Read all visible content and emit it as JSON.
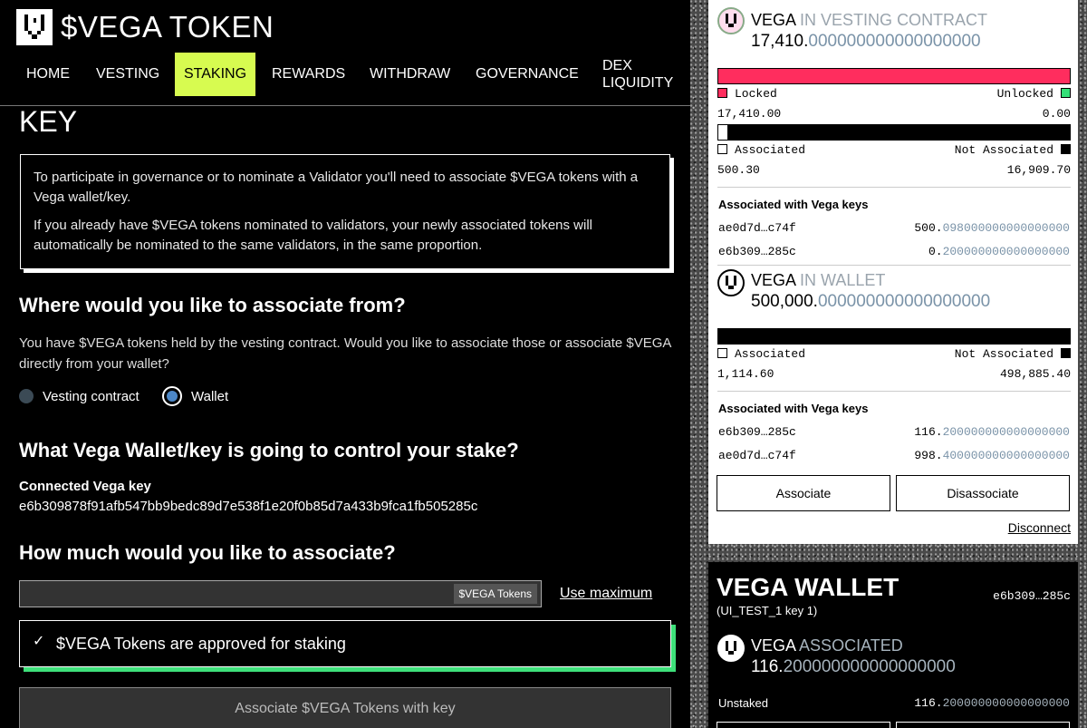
{
  "header": {
    "brand": "$VEGA TOKEN",
    "nav": [
      {
        "label": "HOME"
      },
      {
        "label": "VESTING"
      },
      {
        "label": "STAKING",
        "active": true
      },
      {
        "label": "REWARDS"
      },
      {
        "label": "WITHDRAW"
      },
      {
        "label": "GOVERNANCE"
      },
      {
        "label": "DEX LIQUIDITY"
      }
    ]
  },
  "main": {
    "heading": "KEY",
    "info": {
      "p1": "To participate in governance or to nominate a Validator you'll need to associate $VEGA tokens with a Vega wallet/key.",
      "p2": "If you already have $VEGA tokens nominated to validators, your newly associated tokens will automatically be nominated to the same validators, in the same proportion."
    },
    "from_heading": "Where would you like to associate from?",
    "from_text": "You have $VEGA tokens held by the vesting contract. Would you like to associate those or associate $VEGA directly from your wallet?",
    "radio_options": [
      {
        "label": "Vesting contract",
        "selected": false
      },
      {
        "label": "Wallet",
        "selected": true
      }
    ],
    "control_heading": "What Vega Wallet/key is going to control your stake?",
    "connected_label": "Connected Vega key",
    "connected_key": "e6b309878f91afb547bb9bedc89d7e538f1e20f0b85d7a433b9fca1fb505285c",
    "amount_heading": "How much would you like to associate?",
    "amount_value": "",
    "token_suffix": "$VEGA Tokens",
    "use_max": "Use maximum",
    "approved": "$VEGA Tokens are approved for staking",
    "associate_button": "Associate $VEGA Tokens with key"
  },
  "vesting": {
    "token": "VEGA",
    "title_suffix": "IN VESTING CONTRACT",
    "amount_int": "17,410.",
    "amount_dec": "000000000000000000",
    "locked_label": "Locked",
    "unlocked_label": "Unlocked",
    "locked_value": "17,410.00",
    "unlocked_value": "0.00",
    "locked_fraction": 1.0,
    "associated_label": "Associated",
    "not_associated_label": "Not Associated",
    "associated_value": "500.30",
    "not_associated_value": "16,909.70",
    "associated_fraction": 0.03,
    "keys_heading": "Associated with Vega keys",
    "keys": [
      {
        "key": "ae0d7d…c74f",
        "int": "500.",
        "dec": "098000000000000000"
      },
      {
        "key": "e6b309…285c",
        "int": "0.",
        "dec": "200000000000000000"
      }
    ]
  },
  "wallet": {
    "token": "VEGA",
    "title_suffix": "IN WALLET",
    "amount_int": "500,000.",
    "amount_dec": "000000000000000000",
    "associated_label": "Associated",
    "not_associated_label": "Not Associated",
    "associated_value": "1,114.60",
    "not_associated_value": "498,885.40",
    "associated_fraction": 0.002,
    "keys_heading": "Associated with Vega keys",
    "keys": [
      {
        "key": "e6b309…285c",
        "int": "116.",
        "dec": "200000000000000000"
      },
      {
        "key": "ae0d7d…c74f",
        "int": "998.",
        "dec": "400000000000000000"
      }
    ],
    "associate_button": "Associate",
    "disassociate_button": "Disassociate",
    "disconnect": "Disconnect"
  },
  "vega_wallet": {
    "title": "VEGA WALLET",
    "key_short": "e6b309…285c",
    "subtitle": "(UI_TEST_1 key 1)",
    "token": "VEGA",
    "title_suffix": "ASSOCIATED",
    "amount_int": "116.",
    "amount_dec": "200000000000000000",
    "unstaked_label": "Unstaked",
    "unstaked_int": "116.",
    "unstaked_dec": "200000000000000000"
  },
  "colors": {
    "active_nav": "#d7fb50",
    "locked": "#ff2d5e",
    "unlocked": "#33e077",
    "approved_accent": "#3ee07a",
    "decimal_dim": "#7a93a8"
  }
}
